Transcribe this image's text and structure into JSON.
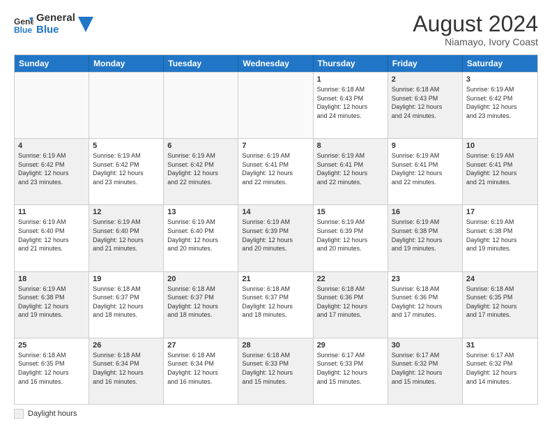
{
  "header": {
    "logo_line1": "General",
    "logo_line2": "Blue",
    "month_year": "August 2024",
    "location": "Niamayo, Ivory Coast"
  },
  "day_headers": [
    "Sunday",
    "Monday",
    "Tuesday",
    "Wednesday",
    "Thursday",
    "Friday",
    "Saturday"
  ],
  "weeks": [
    [
      {
        "day": "",
        "info": "",
        "empty": true
      },
      {
        "day": "",
        "info": "",
        "empty": true
      },
      {
        "day": "",
        "info": "",
        "empty": true
      },
      {
        "day": "",
        "info": "",
        "empty": true
      },
      {
        "day": "1",
        "info": "Sunrise: 6:18 AM\nSunset: 6:43 PM\nDaylight: 12 hours\nand 24 minutes.",
        "shaded": false
      },
      {
        "day": "2",
        "info": "Sunrise: 6:18 AM\nSunset: 6:43 PM\nDaylight: 12 hours\nand 24 minutes.",
        "shaded": true
      },
      {
        "day": "3",
        "info": "Sunrise: 6:19 AM\nSunset: 6:42 PM\nDaylight: 12 hours\nand 23 minutes.",
        "shaded": false
      }
    ],
    [
      {
        "day": "4",
        "info": "Sunrise: 6:19 AM\nSunset: 6:42 PM\nDaylight: 12 hours\nand 23 minutes.",
        "shaded": true
      },
      {
        "day": "5",
        "info": "Sunrise: 6:19 AM\nSunset: 6:42 PM\nDaylight: 12 hours\nand 23 minutes.",
        "shaded": false
      },
      {
        "day": "6",
        "info": "Sunrise: 6:19 AM\nSunset: 6:42 PM\nDaylight: 12 hours\nand 22 minutes.",
        "shaded": true
      },
      {
        "day": "7",
        "info": "Sunrise: 6:19 AM\nSunset: 6:41 PM\nDaylight: 12 hours\nand 22 minutes.",
        "shaded": false
      },
      {
        "day": "8",
        "info": "Sunrise: 6:19 AM\nSunset: 6:41 PM\nDaylight: 12 hours\nand 22 minutes.",
        "shaded": true
      },
      {
        "day": "9",
        "info": "Sunrise: 6:19 AM\nSunset: 6:41 PM\nDaylight: 12 hours\nand 22 minutes.",
        "shaded": false
      },
      {
        "day": "10",
        "info": "Sunrise: 6:19 AM\nSunset: 6:41 PM\nDaylight: 12 hours\nand 21 minutes.",
        "shaded": true
      }
    ],
    [
      {
        "day": "11",
        "info": "Sunrise: 6:19 AM\nSunset: 6:40 PM\nDaylight: 12 hours\nand 21 minutes.",
        "shaded": false
      },
      {
        "day": "12",
        "info": "Sunrise: 6:19 AM\nSunset: 6:40 PM\nDaylight: 12 hours\nand 21 minutes.",
        "shaded": true
      },
      {
        "day": "13",
        "info": "Sunrise: 6:19 AM\nSunset: 6:40 PM\nDaylight: 12 hours\nand 20 minutes.",
        "shaded": false
      },
      {
        "day": "14",
        "info": "Sunrise: 6:19 AM\nSunset: 6:39 PM\nDaylight: 12 hours\nand 20 minutes.",
        "shaded": true
      },
      {
        "day": "15",
        "info": "Sunrise: 6:19 AM\nSunset: 6:39 PM\nDaylight: 12 hours\nand 20 minutes.",
        "shaded": false
      },
      {
        "day": "16",
        "info": "Sunrise: 6:19 AM\nSunset: 6:38 PM\nDaylight: 12 hours\nand 19 minutes.",
        "shaded": true
      },
      {
        "day": "17",
        "info": "Sunrise: 6:19 AM\nSunset: 6:38 PM\nDaylight: 12 hours\nand 19 minutes.",
        "shaded": false
      }
    ],
    [
      {
        "day": "18",
        "info": "Sunrise: 6:19 AM\nSunset: 6:38 PM\nDaylight: 12 hours\nand 19 minutes.",
        "shaded": true
      },
      {
        "day": "19",
        "info": "Sunrise: 6:18 AM\nSunset: 6:37 PM\nDaylight: 12 hours\nand 18 minutes.",
        "shaded": false
      },
      {
        "day": "20",
        "info": "Sunrise: 6:18 AM\nSunset: 6:37 PM\nDaylight: 12 hours\nand 18 minutes.",
        "shaded": true
      },
      {
        "day": "21",
        "info": "Sunrise: 6:18 AM\nSunset: 6:37 PM\nDaylight: 12 hours\nand 18 minutes.",
        "shaded": false
      },
      {
        "day": "22",
        "info": "Sunrise: 6:18 AM\nSunset: 6:36 PM\nDaylight: 12 hours\nand 17 minutes.",
        "shaded": true
      },
      {
        "day": "23",
        "info": "Sunrise: 6:18 AM\nSunset: 6:36 PM\nDaylight: 12 hours\nand 17 minutes.",
        "shaded": false
      },
      {
        "day": "24",
        "info": "Sunrise: 6:18 AM\nSunset: 6:35 PM\nDaylight: 12 hours\nand 17 minutes.",
        "shaded": true
      }
    ],
    [
      {
        "day": "25",
        "info": "Sunrise: 6:18 AM\nSunset: 6:35 PM\nDaylight: 12 hours\nand 16 minutes.",
        "shaded": false
      },
      {
        "day": "26",
        "info": "Sunrise: 6:18 AM\nSunset: 6:34 PM\nDaylight: 12 hours\nand 16 minutes.",
        "shaded": true
      },
      {
        "day": "27",
        "info": "Sunrise: 6:18 AM\nSunset: 6:34 PM\nDaylight: 12 hours\nand 16 minutes.",
        "shaded": false
      },
      {
        "day": "28",
        "info": "Sunrise: 6:18 AM\nSunset: 6:33 PM\nDaylight: 12 hours\nand 15 minutes.",
        "shaded": true
      },
      {
        "day": "29",
        "info": "Sunrise: 6:17 AM\nSunset: 6:33 PM\nDaylight: 12 hours\nand 15 minutes.",
        "shaded": false
      },
      {
        "day": "30",
        "info": "Sunrise: 6:17 AM\nSunset: 6:32 PM\nDaylight: 12 hours\nand 15 minutes.",
        "shaded": true
      },
      {
        "day": "31",
        "info": "Sunrise: 6:17 AM\nSunset: 6:32 PM\nDaylight: 12 hours\nand 14 minutes.",
        "shaded": false
      }
    ]
  ],
  "footer": {
    "daylight_label": "Daylight hours"
  }
}
